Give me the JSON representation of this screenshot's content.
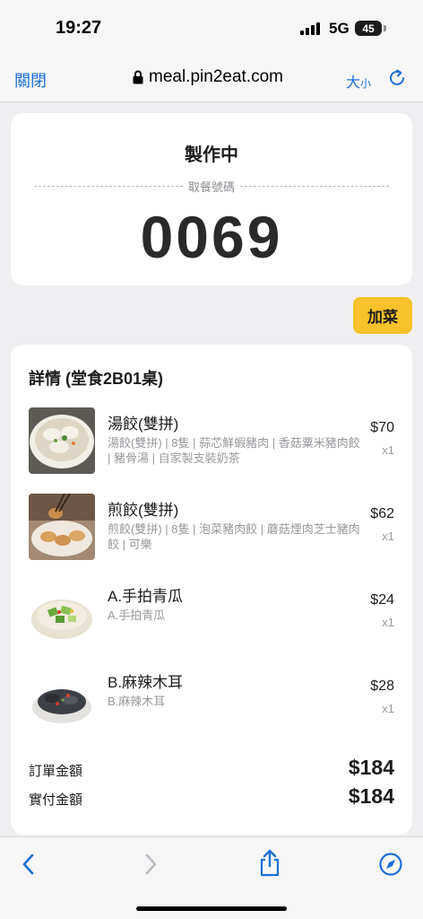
{
  "status_bar": {
    "time": "19:27",
    "network": "5G",
    "battery": "45"
  },
  "browser": {
    "close_label": "關閉",
    "url": "meal.pin2eat.com",
    "text_size_big": "大",
    "text_size_small": "小"
  },
  "order": {
    "status": "製作中",
    "pickup_label": "取餐號碼",
    "pickup_number": "0069",
    "add_dish_label": "加菜"
  },
  "details": {
    "title": "詳情 (堂食2B01桌)",
    "items": [
      {
        "name": "湯餃(雙拼)",
        "desc": "湯餃(雙拼) | 8隻 | 蒜芯鮮蝦豬肉 | 香菇粟米豬肉餃 | 豬骨湯 | 自家製支裝奶茶",
        "price": "$70",
        "qty": "x1",
        "image_icon": "soup-dumplings-photo"
      },
      {
        "name": "煎餃(雙拼)",
        "desc": "煎餃(雙拼) | 8隻 | 泡菜豬肉餃 | 蘑菇煙肉芝士豬肉餃 | 可樂",
        "price": "$62",
        "qty": "x1",
        "image_icon": "fried-dumplings-photo"
      },
      {
        "name": "A.手拍青瓜",
        "desc": "A.手拍青瓜",
        "price": "$24",
        "qty": "x1",
        "image_icon": "cucumber-salad-photo"
      },
      {
        "name": "B.麻辣木耳",
        "desc": "B.麻辣木耳",
        "price": "$28",
        "qty": "x1",
        "image_icon": "spicy-fungus-photo"
      }
    ],
    "order_amount_label": "訂單金額",
    "order_amount": "$184",
    "paid_amount_label": "實付金額",
    "paid_amount": "$184"
  },
  "colors": {
    "accent_blue": "#1b6fd8",
    "add_button": "#f7c22a",
    "background": "#efeff2"
  }
}
